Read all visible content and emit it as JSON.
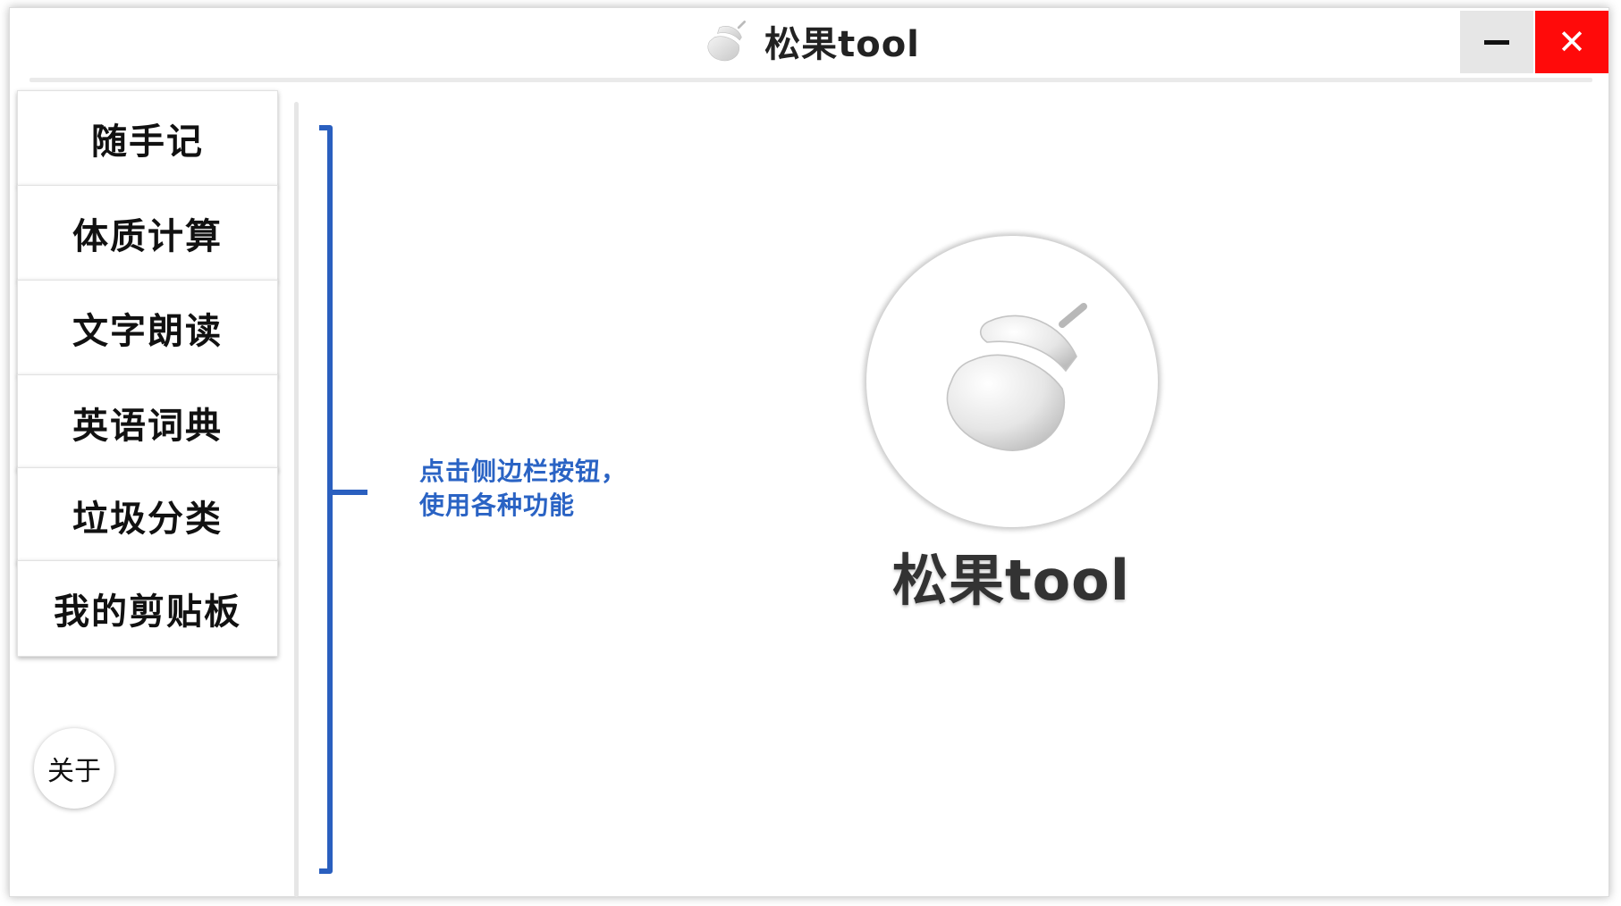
{
  "window": {
    "title": "松果tool",
    "minimize_symbol": "–",
    "close_symbol": "✕",
    "close_color": "#ff0a0a"
  },
  "sidebar": {
    "items": [
      {
        "label": "随手记"
      },
      {
        "label": "体质计算"
      },
      {
        "label": "文字朗读"
      },
      {
        "label": "英语词典"
      },
      {
        "label": "垃圾分类"
      },
      {
        "label": "我的剪贴板"
      }
    ],
    "about_label": "关于"
  },
  "main": {
    "hint": "点击侧边栏按钮，\n使用各种功能",
    "hint_color": "#2a63c4",
    "logo_text": "松果tool",
    "logo_icon": "acorn-icon"
  }
}
